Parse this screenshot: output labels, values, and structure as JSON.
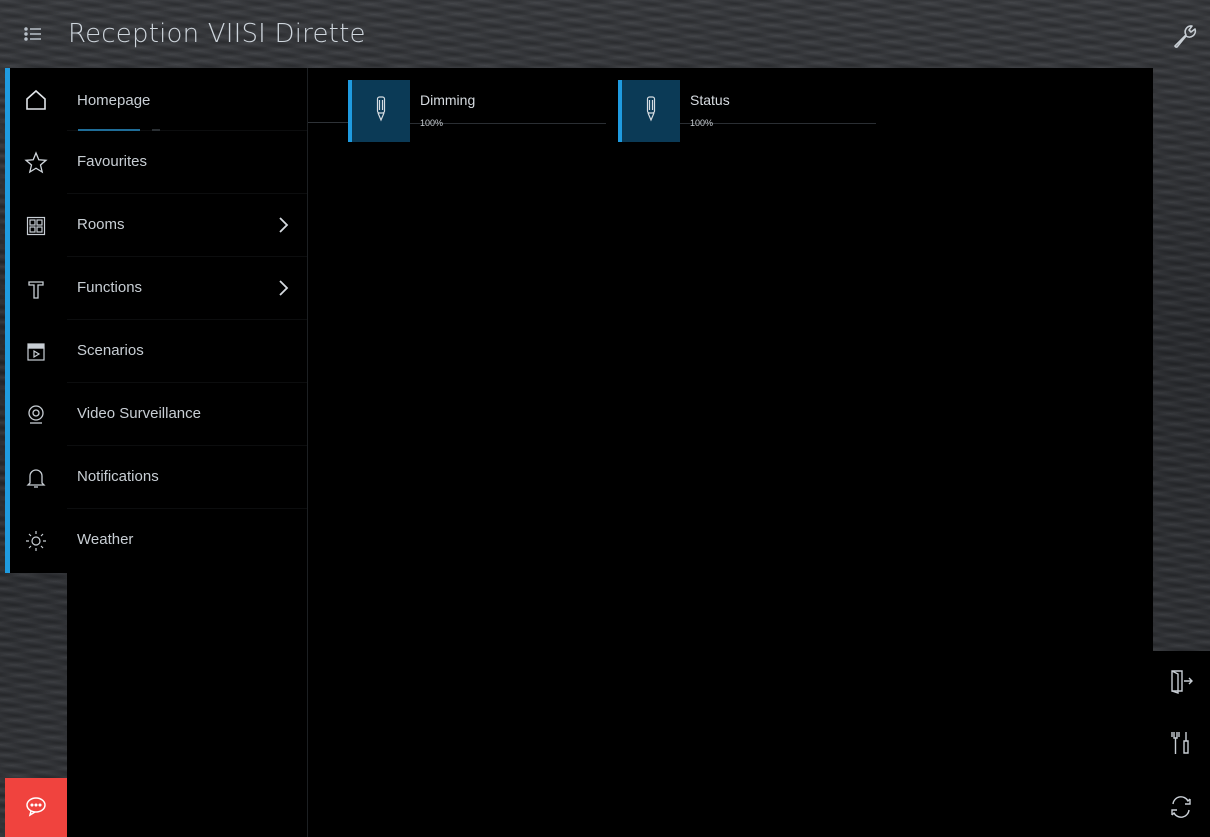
{
  "header": {
    "title": "Reception VIISI Dirette",
    "menu_icon": "list-menu-icon",
    "settings_icon": "wrench-icon"
  },
  "colors": {
    "accent": "#1f9be0",
    "tile_bg": "#0b3a56",
    "chat_button": "#f0433e",
    "panel_bg": "#000000"
  },
  "sidebar": {
    "active": "Homepage",
    "items": [
      {
        "label": "Homepage",
        "icon": "home-icon",
        "has_submenu": false
      },
      {
        "label": "Favourites",
        "icon": "star-icon",
        "has_submenu": false
      },
      {
        "label": "Rooms",
        "icon": "rooms-grid-icon",
        "has_submenu": true
      },
      {
        "label": "Functions",
        "icon": "hammer-icon",
        "has_submenu": true
      },
      {
        "label": "Scenarios",
        "icon": "clapperboard-icon",
        "has_submenu": false
      },
      {
        "label": "Video Surveillance",
        "icon": "webcam-icon",
        "has_submenu": false
      },
      {
        "label": "Notifications",
        "icon": "bell-icon",
        "has_submenu": false
      },
      {
        "label": "Weather",
        "icon": "sun-icon",
        "has_submenu": false
      }
    ],
    "chat_icon": "chat-bubble-icon"
  },
  "main": {
    "tiles": [
      {
        "name": "Dimming",
        "value": "100%",
        "icon": "light-dimmer-icon"
      },
      {
        "name": "Status",
        "value": "100%",
        "icon": "light-dimmer-icon"
      }
    ]
  },
  "right_panel": {
    "buttons": [
      "logout-icon",
      "tools-icon",
      "sync-icon"
    ]
  }
}
